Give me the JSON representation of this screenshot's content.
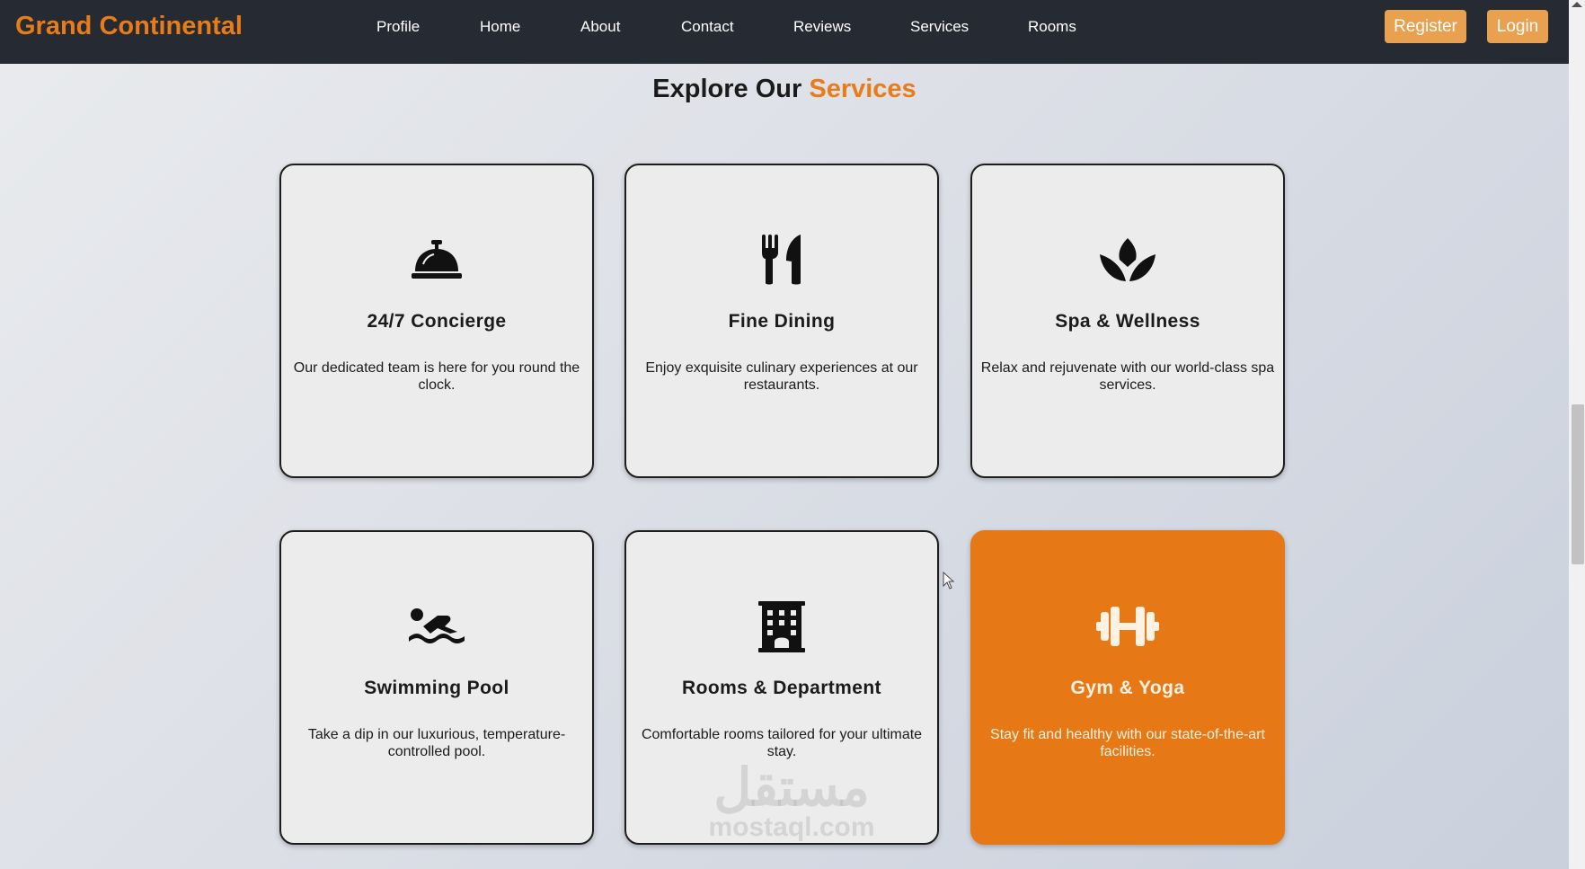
{
  "brand": {
    "name": "Grand Continental",
    "color": "#e77c18"
  },
  "nav": {
    "links": [
      {
        "label": "Profile"
      },
      {
        "label": "Home"
      },
      {
        "label": "About"
      },
      {
        "label": "Contact"
      },
      {
        "label": "Reviews"
      },
      {
        "label": "Services"
      },
      {
        "label": "Rooms"
      }
    ],
    "register_label": "Register",
    "login_label": "Login"
  },
  "section": {
    "title_prefix": "Explore Our",
    "title_accent": "Services"
  },
  "services": [
    {
      "icon": "bell-concierge-icon",
      "title": "24/7 Concierge",
      "description": "Our dedicated team is here for you round the clock."
    },
    {
      "icon": "utensils-icon",
      "title": "Fine Dining",
      "description": "Enjoy exquisite culinary experiences at our restaurants."
    },
    {
      "icon": "spa-lotus-icon",
      "title": "Spa & Wellness",
      "description": "Relax and rejuvenate with our world-class spa services."
    },
    {
      "icon": "swimmer-icon",
      "title": "Swimming Pool",
      "description": "Take a dip in our luxurious, temperature-controlled pool."
    },
    {
      "icon": "hotel-building-icon",
      "title": "Rooms & Department",
      "description": "Comfortable rooms tailored for your ultimate stay."
    },
    {
      "icon": "dumbbell-icon",
      "title": "Gym & Yoga",
      "description": "Stay fit and healthy with our state-of-the-art facilities.",
      "highlighted": true
    }
  ],
  "colors": {
    "navbar_bg": "#262a33",
    "accent": "#e77c18",
    "button_bg": "#e9a04f",
    "highlight_card": "#e67816"
  },
  "watermark": {
    "arabic": "مستقل",
    "latin": "mostaql.com"
  }
}
